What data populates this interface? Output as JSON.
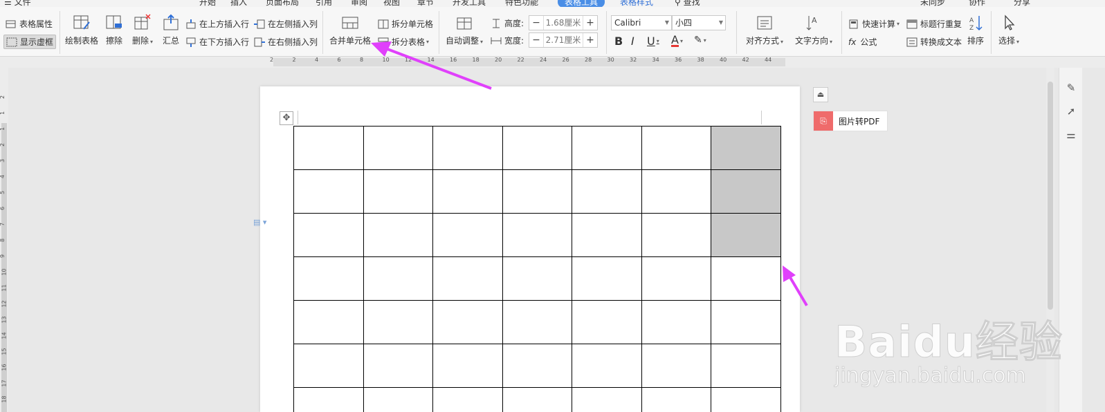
{
  "menubar": {
    "file": "文件",
    "tabs": [
      "开始",
      "插入",
      "页面布局",
      "引用",
      "审阅",
      "视图",
      "章节",
      "开发工具",
      "特色功能"
    ],
    "active_tab": "表格工具",
    "style_tab": "表格样式",
    "search": "查找",
    "sync": "未同步",
    "collab": "协作",
    "share": "分享"
  },
  "ribbon": {
    "table_props": "表格属性",
    "show_gridlines": "显示虚框",
    "draw_table": "绘制表格",
    "erase": "擦除",
    "delete": "删除",
    "summary": "汇总",
    "insert_above": "在上方插入行",
    "insert_below": "在下方插入行",
    "insert_left": "在左侧插入列",
    "insert_right": "在右侧插入列",
    "merge_cells": "合并单元格",
    "split_cells": "拆分单元格",
    "split_table": "拆分表格",
    "auto_fit": "自动调整",
    "height_label": "高度:",
    "height_value": "1.68厘米",
    "width_label": "宽度:",
    "width_value": "2.71厘米",
    "font_name": "Calibri",
    "font_size": "小四",
    "bold": "B",
    "italic": "I",
    "underline": "U",
    "font_color": "A",
    "align": "对齐方式",
    "text_dir": "文字方向",
    "quick_calc": "快速计算",
    "formula": "公式",
    "repeat_header": "标题行重复",
    "to_text": "转换成文本",
    "sort": "排序",
    "select": "选择"
  },
  "ruler": {
    "h_ticks": [
      "2",
      "2",
      "4",
      "6",
      "8",
      "10",
      "12",
      "14",
      "16",
      "18",
      "20",
      "22",
      "24",
      "26",
      "28",
      "30",
      "32",
      "34",
      "36",
      "38",
      "40",
      "42",
      "44"
    ],
    "v_ticks": [
      "2",
      "1",
      "1",
      "2",
      "3",
      "4",
      "5",
      "6",
      "7",
      "8",
      "9",
      "10",
      "11",
      "12",
      "13",
      "14",
      "15",
      "16",
      "17",
      "18"
    ]
  },
  "document": {
    "table": {
      "rows": 7,
      "cols": 7,
      "selected_cells": [
        [
          0,
          6
        ],
        [
          1,
          6
        ],
        [
          2,
          6
        ]
      ]
    }
  },
  "side": {
    "pdf_label": "图片转PDF"
  },
  "watermark": {
    "brand": "Baidu经验",
    "url": "jingyan.baidu.com"
  },
  "colors": {
    "arrow": "#e040fb",
    "active_tab": "#4a8ee6",
    "selected_cell": "#c8c8c8",
    "pdf_icon": "#ef6b6b"
  }
}
